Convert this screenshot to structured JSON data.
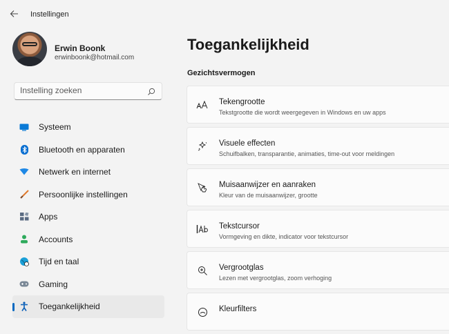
{
  "window": {
    "title": "Instellingen",
    "back_icon": "arrow-left-icon"
  },
  "user": {
    "name": "Erwin Boonk",
    "email": "erwinboonk@hotmail.com"
  },
  "search": {
    "placeholder": "Instelling zoeken",
    "icon": "search-icon"
  },
  "sidebar": {
    "items": [
      {
        "label": "Systeem",
        "icon": "system-icon",
        "color": "#0a7ad6"
      },
      {
        "label": "Bluetooth en apparaten",
        "icon": "bluetooth-icon",
        "color": "#0a6fd1"
      },
      {
        "label": "Netwerk en internet",
        "icon": "network-icon",
        "color": "#1e88e5"
      },
      {
        "label": "Persoonlijke instellingen",
        "icon": "brush-icon",
        "color": "#e0792b"
      },
      {
        "label": "Apps",
        "icon": "apps-icon",
        "color": "#5a6b82"
      },
      {
        "label": "Accounts",
        "icon": "account-icon",
        "color": "#2eaa5c"
      },
      {
        "label": "Tijd en taal",
        "icon": "globe-clock-icon",
        "color": "#1aa0d8"
      },
      {
        "label": "Gaming",
        "icon": "gamepad-icon",
        "color": "#7a8896"
      },
      {
        "label": "Toegankelijkheid",
        "icon": "accessibility-icon",
        "color": "#0a5fb8",
        "active": true
      }
    ]
  },
  "main": {
    "title": "Toegankelijkheid",
    "section": "Gezichtsvermogen",
    "cards": [
      {
        "icon": "text-size-icon",
        "title": "Tekengrootte",
        "subtitle": "Tekstgrootte die wordt weergegeven in Windows en uw apps"
      },
      {
        "icon": "visual-effects-icon",
        "title": "Visuele effecten",
        "subtitle": "Schuifbalken, transparantie, animaties, time-out voor meldingen"
      },
      {
        "icon": "mouse-pointer-touch-icon",
        "title": "Muisaanwijzer en aanraken",
        "subtitle": "Kleur van de muisaanwijzer, grootte"
      },
      {
        "icon": "text-cursor-icon",
        "title": "Tekstcursor",
        "subtitle": "Vormgeving en dikte, indicator voor tekstcursor"
      },
      {
        "icon": "magnifier-icon",
        "title": "Vergrootglas",
        "subtitle": "Lezen met vergrootglas, zoom verhoging"
      },
      {
        "icon": "color-filter-icon",
        "title": "Kleurfilters",
        "subtitle": ""
      }
    ]
  },
  "colors": {
    "accent": "#0067c0",
    "background": "#f3f3f3",
    "card": "#fbfbfb"
  }
}
